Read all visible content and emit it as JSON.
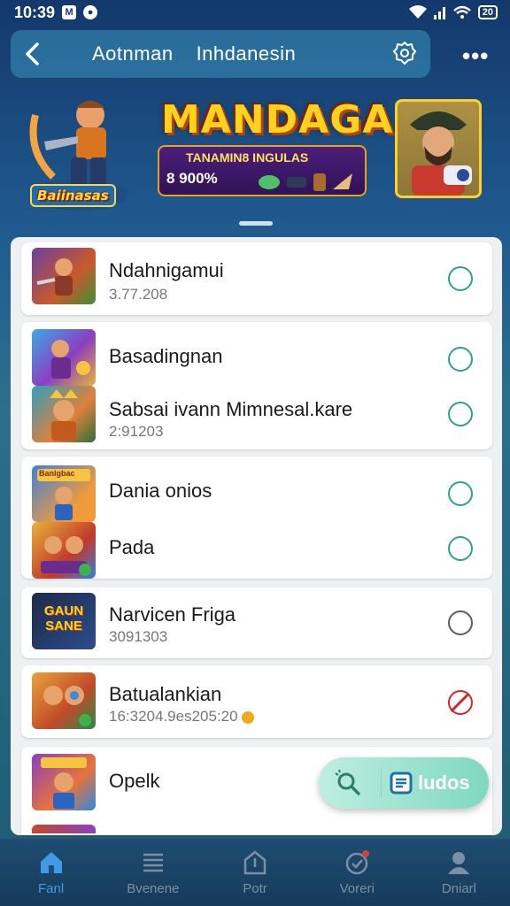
{
  "status_bar": {
    "time": "10:39",
    "battery": "20"
  },
  "header": {
    "title_left": "Aotnman",
    "title_right": "Inhdanesin"
  },
  "banner": {
    "left_label": "Baiinasas",
    "title": "MANDAGA",
    "subtitle": "TANAMIN8 INGULAS",
    "percent": "8 900%"
  },
  "list": {
    "items": [
      {
        "title": "Ndahnigamui",
        "subtitle": "3.77.208",
        "state": "unselected"
      },
      {
        "title": "Basadingnan",
        "subtitle": "",
        "state": "unselected"
      },
      {
        "title": "Sabsai ivann Mimnesal.kare",
        "subtitle": "2:91203",
        "state": "unselected"
      },
      {
        "title": "Dania onios",
        "subtitle": "",
        "state": "unselected"
      },
      {
        "title": "Pada",
        "subtitle": "",
        "state": "unselected"
      },
      {
        "title": "Narvicen Frigа",
        "subtitle": "3091303",
        "state": "neutral"
      },
      {
        "title": "Batualankian",
        "subtitle": "16:3204.9es205:20",
        "state": "blocked"
      },
      {
        "title": "Opelk",
        "subtitle": "",
        "state": "none"
      }
    ],
    "thumb_labels": {
      "gaun": "GAUN SANE",
      "btn": "Banlgbac"
    }
  },
  "pill": {
    "label": "ludos"
  },
  "bottom_nav": {
    "items": [
      {
        "label": "Fanl",
        "icon": "home-icon",
        "active": true
      },
      {
        "label": "Bvenene",
        "icon": "list-icon",
        "active": false
      },
      {
        "label": "Potr",
        "icon": "upload-icon",
        "active": false
      },
      {
        "label": "Voreri",
        "icon": "activity-icon",
        "active": false
      },
      {
        "label": "Dniarl",
        "icon": "profile-icon",
        "active": false
      }
    ]
  },
  "colors": {
    "accent": "#3f9be6",
    "radio": "#2ea38a",
    "blocked": "#d02a2a"
  }
}
